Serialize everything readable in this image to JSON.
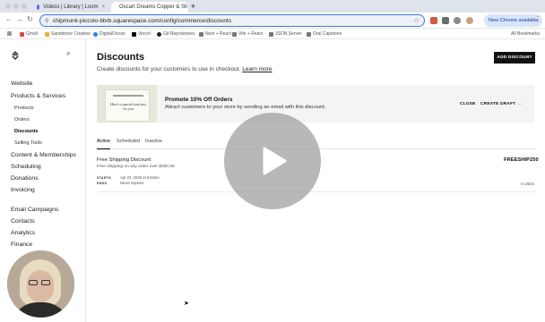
{
  "browser": {
    "tabs": [
      {
        "label": "Videos | Library | Loom",
        "favicon_color": "#625df5"
      },
      {
        "label": "Oscart Dreams Copper & Sh",
        "favicon_color": "#111111"
      }
    ],
    "new_tab": "+",
    "url": "chipmunk-piccolo-bbrb.squarespace.com/config/commerce/discounts",
    "chrome_banner": "New Chrome available",
    "bookmarks": [
      "Gmail",
      "Sandstone Creative",
      "DigitalOcean",
      "Vercel",
      "Git Repositories",
      "Next + React",
      "Vite + React",
      "JSON Server",
      "Oral Capstone"
    ],
    "all_bookmarks": "All Bookmarks"
  },
  "sidebar": {
    "items": [
      {
        "label": "Website",
        "level": 0
      },
      {
        "label": "Products & Services",
        "level": 0
      },
      {
        "label": "Products",
        "level": 1
      },
      {
        "label": "Orders",
        "level": 1
      },
      {
        "label": "Discounts",
        "level": 1,
        "selected": true
      },
      {
        "label": "Selling Tools",
        "level": 1
      },
      {
        "label": "Content & Memberships",
        "level": 0
      },
      {
        "label": "Scheduling",
        "level": 0
      },
      {
        "label": "Donations",
        "level": 0
      },
      {
        "label": "Invoicing",
        "level": 0
      },
      {
        "label": "Email Campaigns",
        "level": 0
      },
      {
        "label": "Contacts",
        "level": 0
      },
      {
        "label": "Analytics",
        "level": 0
      },
      {
        "label": "Finance",
        "level": 0
      }
    ]
  },
  "page": {
    "title": "Discounts",
    "subtitle": "Create discounts for your customers to use in checkout.",
    "learn_more": "Learn more",
    "add_button": "ADD DISCOUNT"
  },
  "promo": {
    "card_text": "Here's a special treat just for you",
    "heading": "Promote 10% Off Orders",
    "body": "Attract customers to your store by sending an email with this discount.",
    "close": "CLOSE",
    "create": "CREATE DRAFT",
    "arrow": "→"
  },
  "tabs": [
    "Active",
    "Scheduled",
    "Inactive"
  ],
  "discount": {
    "name": "Free Shipping Discount",
    "description": "Free shipping on any order over $250.00",
    "code": "FREESHIP250",
    "starts_label": "STARTS",
    "starts_value": "Apr 22, 2025 at 6:53am",
    "ends_label": "ENDS",
    "ends_value": "Never Expires",
    "uses": "0 USES"
  },
  "colors": {
    "accent": "#111111",
    "play_overlay": "#8c8c8c",
    "chrome_banner_bg": "#d7e4fb"
  }
}
